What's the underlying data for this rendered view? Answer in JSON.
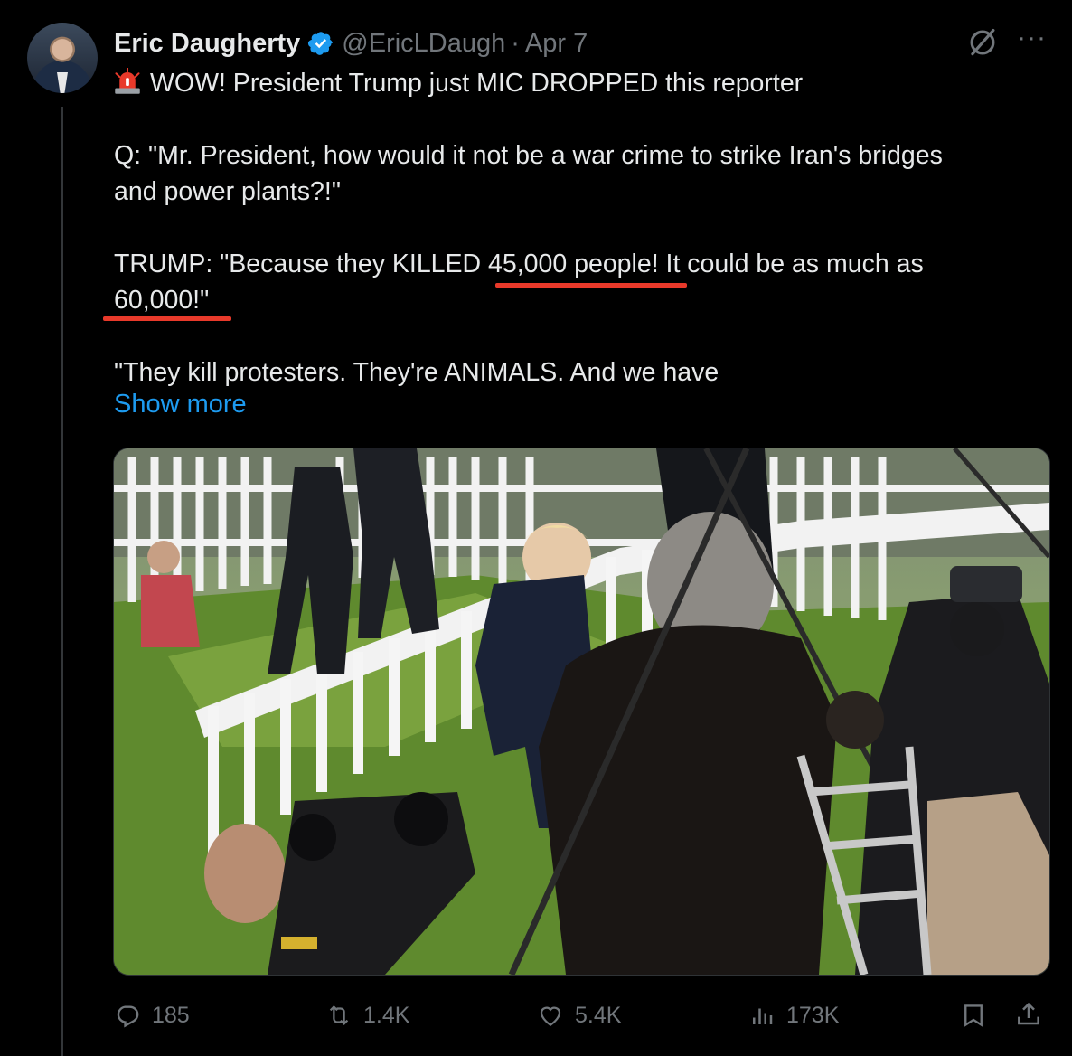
{
  "author": {
    "name": "Eric Daugherty",
    "handle": "@EricLDaugh",
    "separator": "·",
    "date": "Apr 7"
  },
  "icons": {
    "verified": "verified-badge-icon",
    "grok": "grok-icon",
    "more": "more-options-icon",
    "siren": "rotating-light-emoji"
  },
  "tweet": {
    "line1": "WOW! President Trump just MIC DROPPED this reporter",
    "line2": "Q: \"Mr. President, how would it not be a war crime to strike Iran's bridges",
    "line3": "and power plants?!\"",
    "line4": "TRUMP: \"Because they KILLED 45,000 people! It could be as much as",
    "line5": "60,000!\"",
    "line6": "\"They kill protesters. They're ANIMALS. And we have",
    "show_more": "Show more"
  },
  "actions": {
    "replies": "185",
    "reposts": "1.4K",
    "likes": "5.4K",
    "views": "173K"
  },
  "colors": {
    "background": "#000000",
    "text": "#e7e9ea",
    "muted": "#71767b",
    "link": "#1d9bf0",
    "underline": "#e8392a",
    "verified": "#1d9bf0"
  }
}
